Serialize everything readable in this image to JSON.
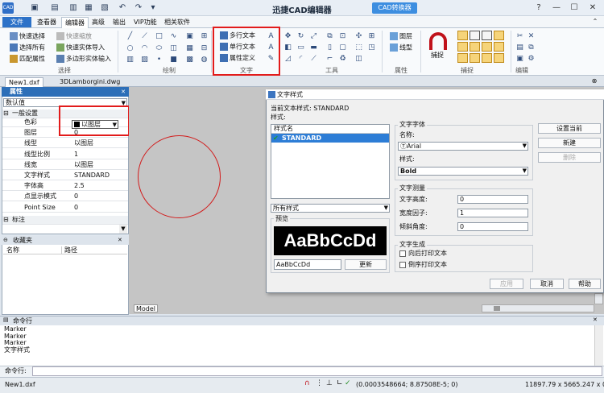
{
  "app": {
    "title": "迅捷CAD编辑器",
    "switch_button": "CAD转换器",
    "logo": "CAD"
  },
  "menu": [
    "文件",
    "查看器",
    "编辑器",
    "高级",
    "输出",
    "VIP功能",
    "相关软件"
  ],
  "ribbon": {
    "select": {
      "items": [
        "快速选择",
        "选择所有",
        "匹配属性",
        "快速缩放",
        "快速实体导入",
        "多边形实体输入"
      ],
      "label": "选择"
    },
    "draw": {
      "label": "绘制"
    },
    "text": {
      "items": [
        "多行文本",
        "单行文本",
        "属性定义"
      ],
      "label": "文字"
    },
    "tools": {
      "label": "工具"
    },
    "prop": {
      "items": [
        "图层",
        "线型"
      ],
      "label": "属性"
    },
    "snap": {
      "label": "捕捉",
      "capture": "捕捉"
    },
    "edit": {
      "label": "编辑"
    }
  },
  "tabs": [
    "New1.dxf",
    "3DLamborgini.dwg"
  ],
  "props": {
    "title": "属性",
    "select": "数认值",
    "section_general": "一般设置",
    "rows": [
      {
        "k": "色彩",
        "v": "以图层"
      },
      {
        "k": "图层",
        "v": "0"
      },
      {
        "k": "线型",
        "v": "以图层"
      },
      {
        "k": "线型比例",
        "v": "1"
      },
      {
        "k": "线宽",
        "v": "以图层"
      },
      {
        "k": "文字样式",
        "v": "STANDARD"
      },
      {
        "k": "字体高",
        "v": "2.5"
      },
      {
        "k": "点显示模式",
        "v": "0"
      },
      {
        "k": "Point Size",
        "v": "0"
      }
    ],
    "section_label": "标注"
  },
  "favorites": {
    "title": "收藏夹",
    "col_name": "名称",
    "col_path": "路径"
  },
  "model_tab": "Model",
  "dialog": {
    "title": "文字样式",
    "current_label": "当前文本样式:",
    "current_value": "STANDARD",
    "styles_label": "样式:",
    "list_header": "样式名",
    "list_items": [
      "STANDARD"
    ],
    "filter": "所有样式",
    "preview_label": "预览",
    "preview_text": "AaBbCcDd",
    "preview_input": "AaBbCcDd",
    "update_button": "更新",
    "font_group": "文字字体",
    "name_label": "名称:",
    "font_name": "Arial",
    "style_label": "样式:",
    "font_style": "Bold",
    "measure_group": "文字测量",
    "height_label": "文字高度:",
    "height_value": "0",
    "width_label": "宽度因子:",
    "width_value": "1",
    "oblique_label": "倾斜角度:",
    "oblique_value": "0",
    "gen_group": "文字生成",
    "backward": "向后打印文本",
    "upside": "倒序打印文本",
    "set_current": "设置当前",
    "new": "新建",
    "delete": "删除",
    "apply": "应用",
    "cancel": "取消",
    "help": "帮助"
  },
  "command": {
    "title": "命令行",
    "lines": [
      "Marker",
      "Marker",
      "Marker",
      "文字样式"
    ],
    "prompt": "命令行:"
  },
  "status": {
    "file": "New1.dxf",
    "coords": "(0.0003548664; 8.87508E-5; 0)",
    "size": "11897.79 x 5665.247 x 0"
  }
}
